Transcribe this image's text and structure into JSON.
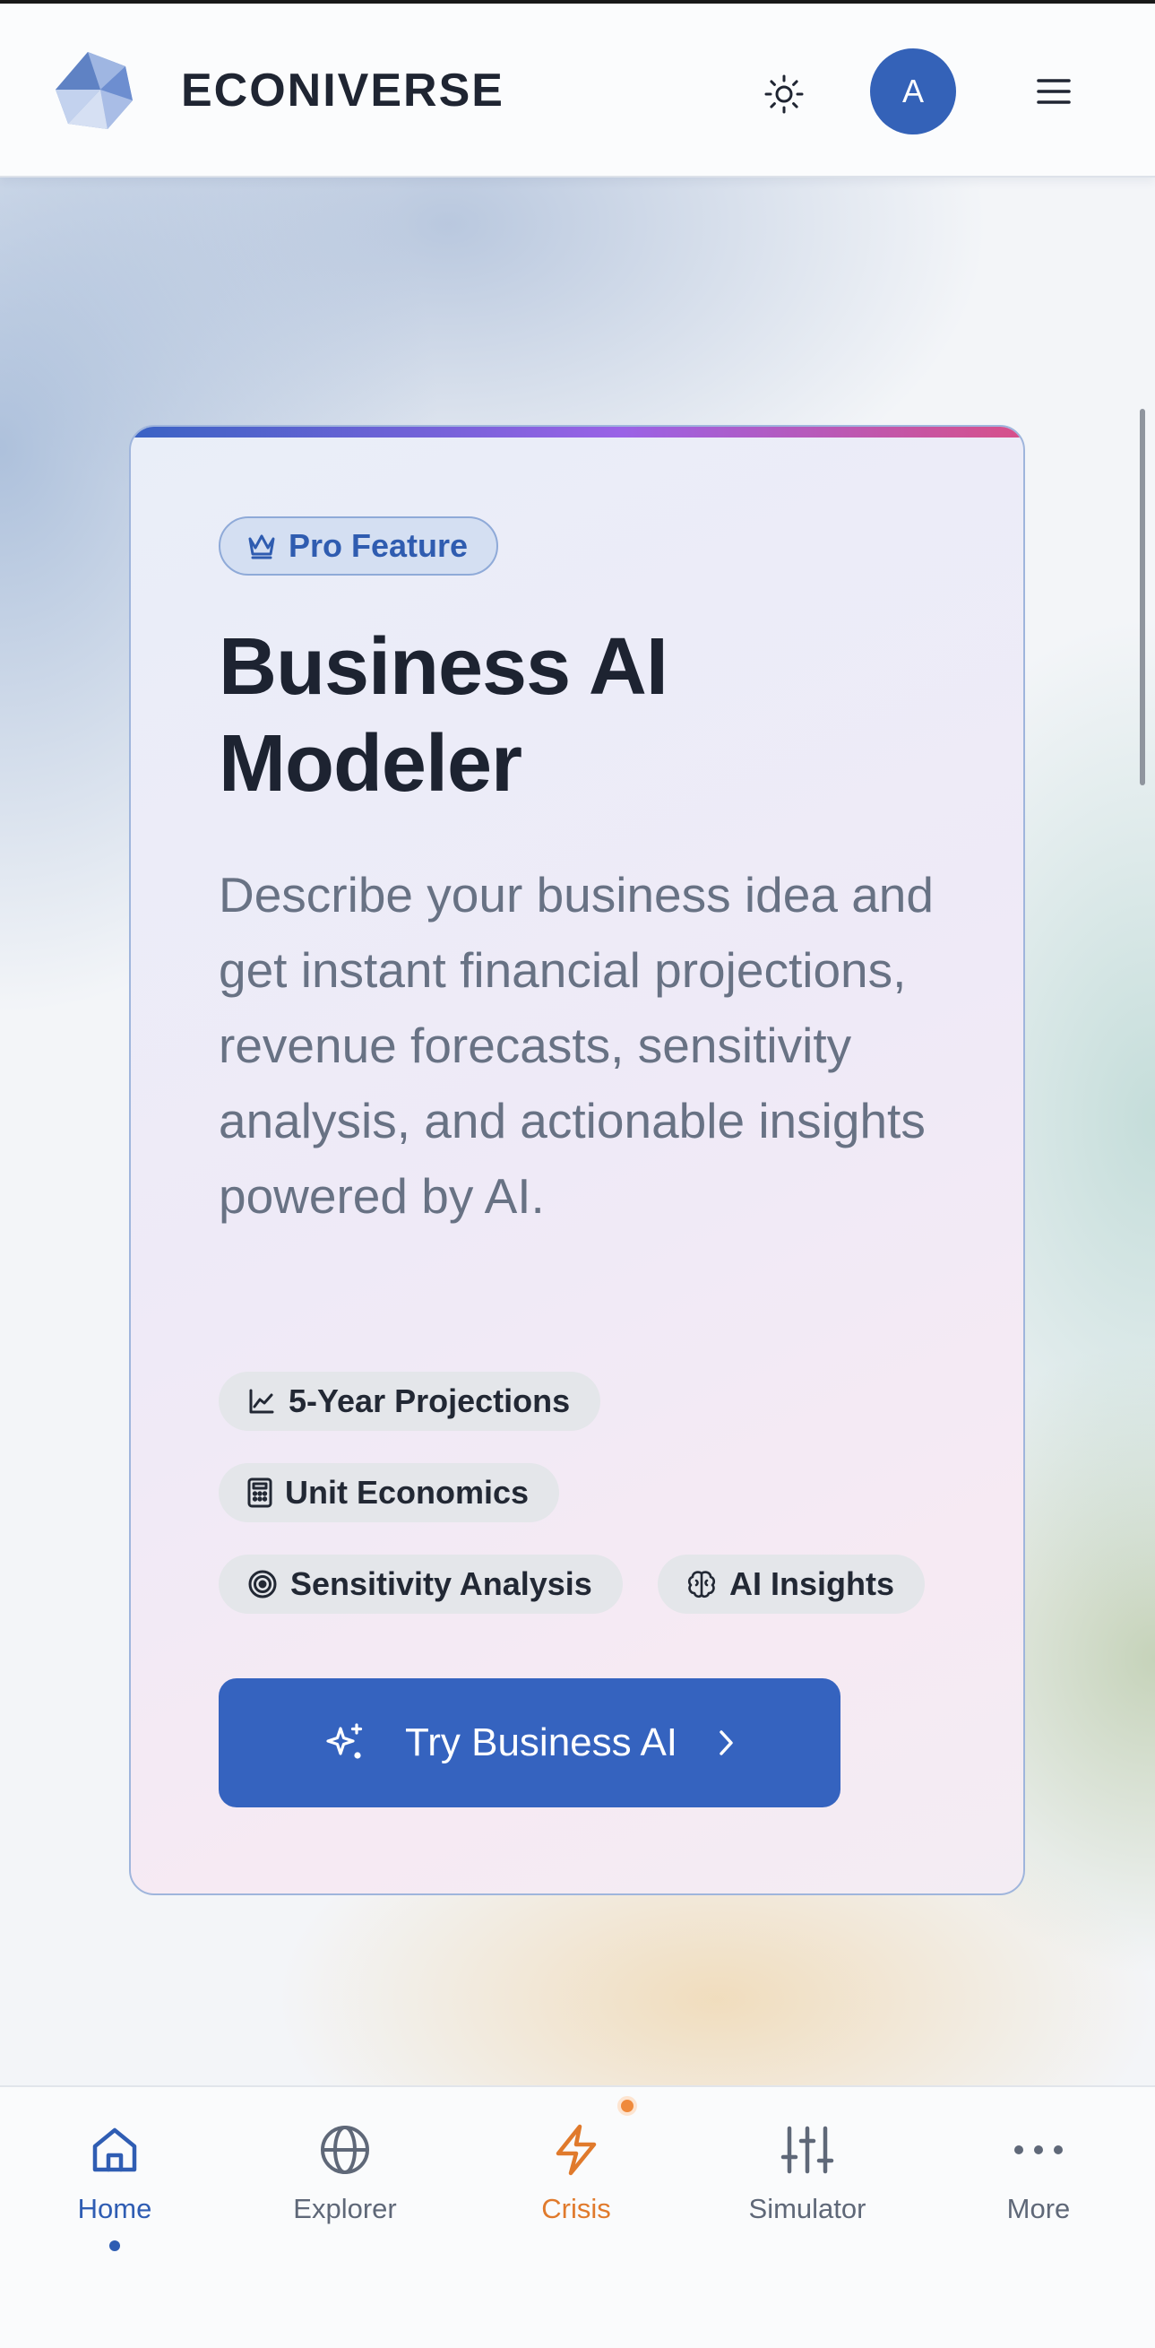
{
  "app": {
    "brand": "ECONIVERSE",
    "avatar_initial": "A"
  },
  "card": {
    "badge": "Pro Feature",
    "title": "Business AI Modeler",
    "description": "Describe your business idea and get instant financial projections, revenue forecasts, sensitivity analysis, and actionable insights powered by AI.",
    "features": [
      {
        "label": "5-Year Projections",
        "icon": "chart-line-icon"
      },
      {
        "label": "Unit Economics",
        "icon": "calculator-icon"
      },
      {
        "label": "Sensitivity Analysis",
        "icon": "target-icon"
      },
      {
        "label": "AI Insights",
        "icon": "brain-icon"
      }
    ],
    "cta_label": "Try Business AI"
  },
  "nav": {
    "items": [
      {
        "label": "Home",
        "icon": "home-icon",
        "active": true
      },
      {
        "label": "Explorer",
        "icon": "globe-icon"
      },
      {
        "label": "Crisis",
        "icon": "lightning-icon",
        "has_notification": true
      },
      {
        "label": "Simulator",
        "icon": "sliders-icon"
      },
      {
        "label": "More",
        "icon": "more-icon"
      }
    ]
  },
  "colors": {
    "primary": "#3563bf",
    "crisis": "#e07a2c",
    "accent_gradient": [
      "#3a63c4",
      "#9a62e6",
      "#d7508a"
    ]
  }
}
